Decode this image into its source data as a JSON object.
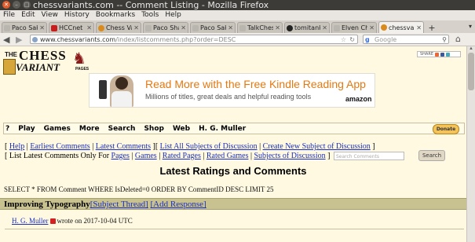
{
  "window": {
    "title": "chessvariants.com -- Comment Listing - Mozilla Firefox"
  },
  "menu": [
    "File",
    "Edit",
    "View",
    "History",
    "Bookmarks",
    "Tools",
    "Help"
  ],
  "tabs": [
    {
      "label": "Paco Sako a...",
      "icon": "generic-favicon"
    },
    {
      "label": "HCCnet",
      "icon": "hccnet-favicon"
    },
    {
      "label": "Chess Varia...",
      "icon": "cv-favicon"
    },
    {
      "label": "Paco Shako ...",
      "icon": "generic-favicon"
    },
    {
      "label": "Paco Sako p...",
      "icon": "generic-favicon"
    },
    {
      "label": "TalkChess.c...",
      "icon": "generic-favicon"
    },
    {
      "label": "tomitankChe...",
      "icon": "github-favicon"
    },
    {
      "label": "Elven Chess ...",
      "icon": "generic-favicon"
    },
    {
      "label": "chessvarian...",
      "icon": "cv-favicon",
      "active": true
    }
  ],
  "navbar": {
    "url_prefix": "www.chessvariants.com",
    "url_rest": "/index/listcomments.php?order=DESC",
    "search_placeholder": "Google"
  },
  "page": {
    "logo": {
      "the": "THE",
      "chess": "CHESS",
      "variant": "VARIANT",
      "pages": "PAGES"
    },
    "share_label": "SHARE",
    "ad": {
      "headline": "Read More with the Free Kindle Reading App",
      "sub": "Millions of titles, great deals and helpful reading tools",
      "brand": "amazon"
    },
    "topmenu": [
      "?",
      "Play",
      "Games",
      "More",
      "Search",
      "Shop",
      "Web",
      "H. G. Muller"
    ],
    "donate_label": "Donate",
    "links_row1": {
      "open": "[",
      "help": "Help",
      "sep": "|",
      "earliest": "Earliest Comments",
      "latest": "Latest Comments",
      "close1": "][",
      "list_all": "List All Subjects of Discussion",
      "create": "Create New Subject of Discussion",
      "close2": "]"
    },
    "links_row2": {
      "prefix": "[ List Latest Comments Only For",
      "pages": "Pages",
      "games": "Games",
      "rated_pages": "Rated Pages",
      "rated_games": "Rated Games",
      "subjects": "Subjects of Discussion",
      "close": "]",
      "search_placeholder": "Search Comments",
      "search_button": "Search"
    },
    "heading": "Latest Ratings and Comments",
    "sql": "SELECT * FROM Comment WHERE IsDeleted=0 ORDER BY CommentID DESC LIMIT 25",
    "thread": {
      "title": "Improving Typography",
      "subject_link": "[Subject Thread]",
      "add_link": "[Add Response]"
    },
    "comment": {
      "author": "H. G. Muller",
      "text": "wrote on 2017-10-04 UTC"
    }
  }
}
